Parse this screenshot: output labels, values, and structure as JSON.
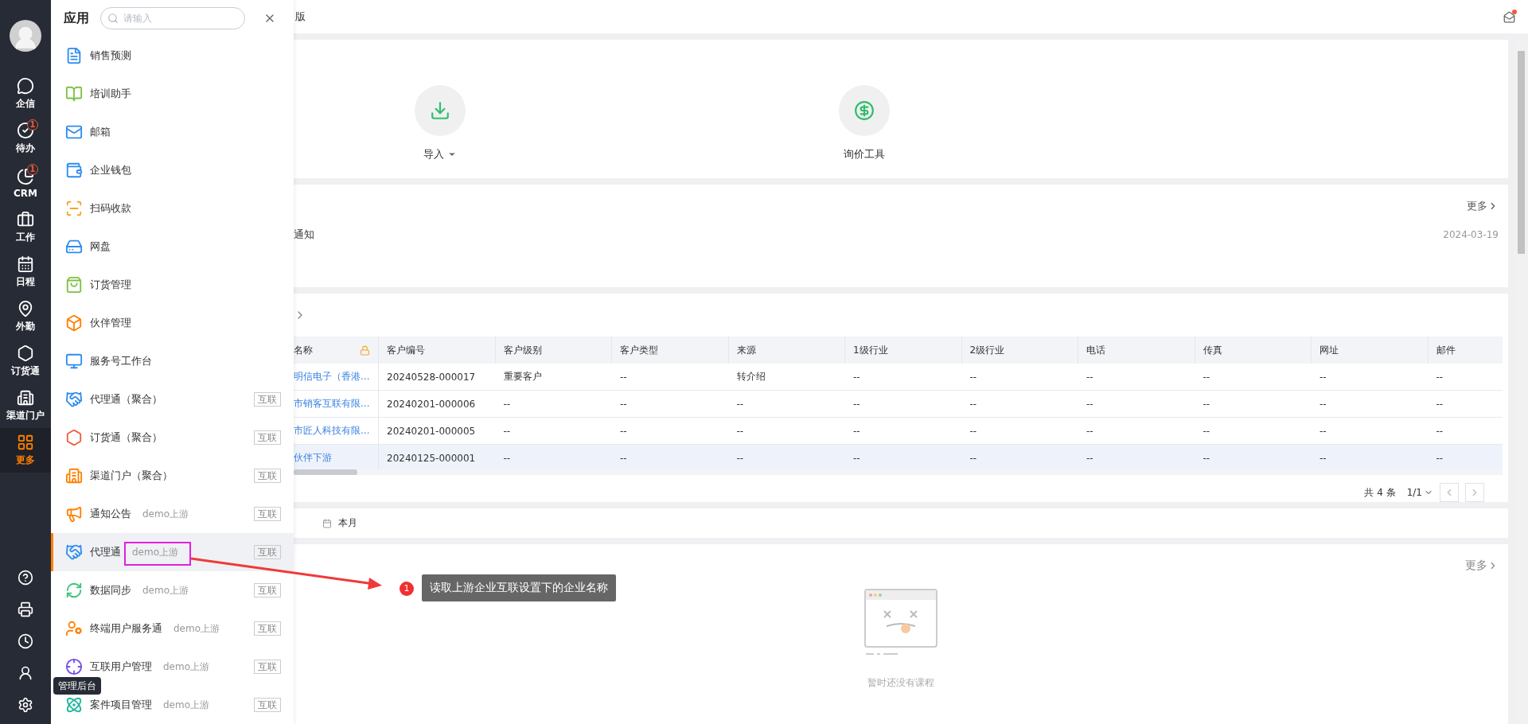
{
  "nav": {
    "items": [
      {
        "label": "企信",
        "selected": false
      },
      {
        "label": "待办",
        "badge": "1",
        "selected": false
      },
      {
        "label": "CRM",
        "badge": "1",
        "selected": false
      },
      {
        "label": "工作",
        "selected": false
      },
      {
        "label": "日程",
        "selected": false
      },
      {
        "label": "外勤",
        "selected": false
      },
      {
        "label": "订货通",
        "selected": false
      },
      {
        "label": "渠道门户",
        "selected": false
      },
      {
        "label": "更多",
        "selected": true
      }
    ],
    "tooltip": "管理后台"
  },
  "apps_panel": {
    "title": "应用",
    "search": {
      "placeholder": "请输入"
    },
    "items": [
      {
        "name": "销售预测",
        "selected": false
      },
      {
        "name": "培训助手",
        "selected": false
      },
      {
        "name": "邮箱",
        "selected": false
      },
      {
        "name": "企业钱包",
        "selected": false
      },
      {
        "name": "扫码收款",
        "selected": false
      },
      {
        "name": "网盘",
        "selected": false
      },
      {
        "name": "订货管理",
        "selected": false
      },
      {
        "name": "伙伴管理",
        "selected": false
      },
      {
        "name": "服务号工作台",
        "selected": false
      },
      {
        "name": "代理通（聚合）",
        "tag": "互联",
        "selected": false
      },
      {
        "name": "订货通（聚合）",
        "tag": "互联",
        "selected": false
      },
      {
        "name": "渠道门户（聚合）",
        "tag": "互联",
        "selected": false
      },
      {
        "name": "通知公告",
        "source": "demo上游",
        "tag": "互联",
        "selected": false
      },
      {
        "name": "代理通",
        "source": "demo上游",
        "tag": "互联",
        "selected": true
      },
      {
        "name": "数据同步",
        "source": "demo上游",
        "tag": "互联",
        "selected": false
      },
      {
        "name": "终端用户服务通",
        "source": "demo上游",
        "tag": "互联",
        "selected": false
      },
      {
        "name": "互联用户管理",
        "source": "demo上游",
        "tag": "互联",
        "selected": false
      },
      {
        "name": "案件项目管理",
        "source": "demo上游",
        "tag": "互联",
        "selected": false
      }
    ]
  },
  "top_bar": {
    "title": "版"
  },
  "quick_tools": [
    {
      "label": "导入",
      "dropdown": true
    },
    {
      "label": "询价工具",
      "dropdown": false
    }
  ],
  "notices": {
    "more": "更多",
    "items": [
      {
        "title": "通知",
        "date": "2024-03-19"
      }
    ]
  },
  "table": {
    "columns": [
      "名称",
      "客户编号",
      "客户级别",
      "客户类型",
      "来源",
      "1级行业",
      "2级行业",
      "电话",
      "传真",
      "网址",
      "邮件"
    ],
    "rows": [
      {
        "selected": false,
        "cells": [
          "明信电子（香港...",
          "20240528-000017",
          "重要客户",
          "--",
          "转介绍",
          "--",
          "--",
          "--",
          "--",
          "--",
          "--"
        ]
      },
      {
        "selected": false,
        "cells": [
          "市销客互联有限...",
          "20240201-000006",
          "--",
          "--",
          "--",
          "--",
          "--",
          "--",
          "--",
          "--",
          "--"
        ]
      },
      {
        "selected": false,
        "cells": [
          "市匠人科技有限...",
          "20240201-000005",
          "--",
          "--",
          "--",
          "--",
          "--",
          "--",
          "--",
          "--",
          "--"
        ]
      },
      {
        "selected": true,
        "cells": [
          "伙伴下游",
          "20240125-000001",
          "--",
          "--",
          "--",
          "--",
          "--",
          "--",
          "--",
          "--",
          "--"
        ]
      }
    ],
    "total": "共 4 条",
    "page": "1/1"
  },
  "date_filter": {
    "label": "本月"
  },
  "courses": {
    "more": "更多",
    "empty": "暂时还没有课程"
  },
  "annotation": {
    "number": "1",
    "text": "读取上游企业互联设置下的企业名称"
  }
}
